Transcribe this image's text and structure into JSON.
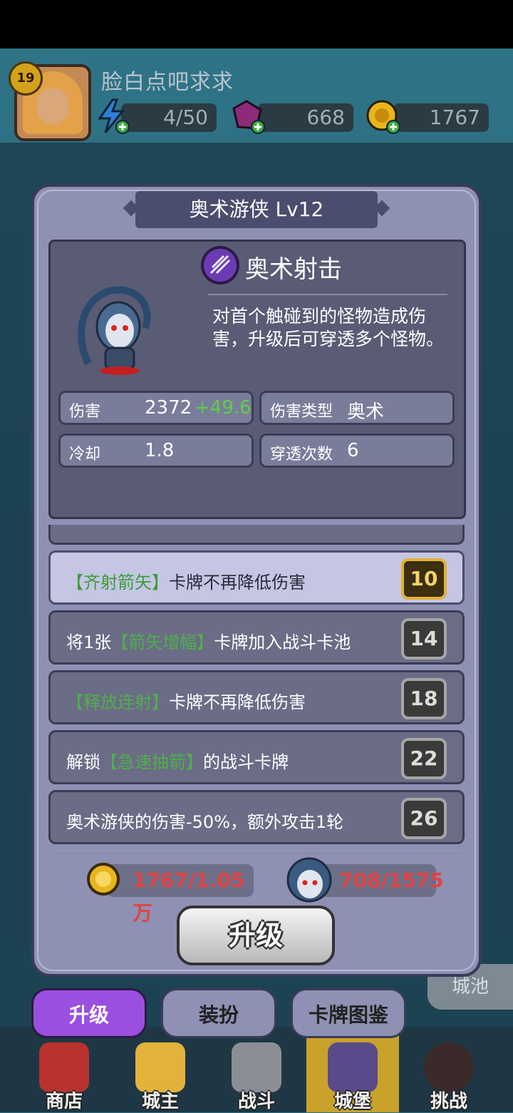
{
  "player": {
    "level": "19",
    "name": "脸白点吧求求",
    "energy": "4/50",
    "gems": "668",
    "gold": "1767"
  },
  "modal": {
    "title": "奥术游侠 Lv12",
    "skill_name": "奥术射击",
    "skill_desc": "对首个触碰到的怪物造成伤害，升级后可穿透多个怪物。",
    "stats": {
      "damage_label": "伤害",
      "damage_value": "2372",
      "damage_bonus": "+49.6",
      "damage_type_label": "伤害类型",
      "damage_type_value": "奥术",
      "cooldown_label": "冷却",
      "cooldown_value": "1.8",
      "pierce_label": "穿透次数",
      "pierce_value": "6"
    },
    "perks": [
      {
        "pre": "",
        "green": "【齐射箭矢】",
        "post": "卡牌不再降低伤害",
        "level": "10",
        "active": true
      },
      {
        "pre": "将1张",
        "green": "【箭矢增幅】",
        "post": "卡牌加入战斗卡池",
        "level": "14",
        "active": false
      },
      {
        "pre": "",
        "green": "【释放连射】",
        "post": "卡牌不再降低伤害",
        "level": "18",
        "active": false
      },
      {
        "pre": "解锁",
        "green": "【急速抽箭】",
        "post": "的战斗卡牌",
        "level": "22",
        "active": false
      },
      {
        "pre": "奥术游侠的伤害-50%，额外攻击1轮",
        "green": "",
        "post": "",
        "level": "26",
        "active": false
      }
    ],
    "cost_gold": "1767/1.05万",
    "cost_shards": "708/1575",
    "upgrade_label": "升级"
  },
  "sub_tabs": [
    "升级",
    "装扮",
    "卡牌图鉴"
  ],
  "side_label": "城池",
  "bottom_nav": [
    "商店",
    "城主",
    "战斗",
    "城堡",
    "挑战"
  ],
  "colors": {
    "accent_purple": "#9b4fe0",
    "gold": "#e9b51c",
    "cost_red": "#e04444",
    "bonus_green": "#4fb04a"
  }
}
